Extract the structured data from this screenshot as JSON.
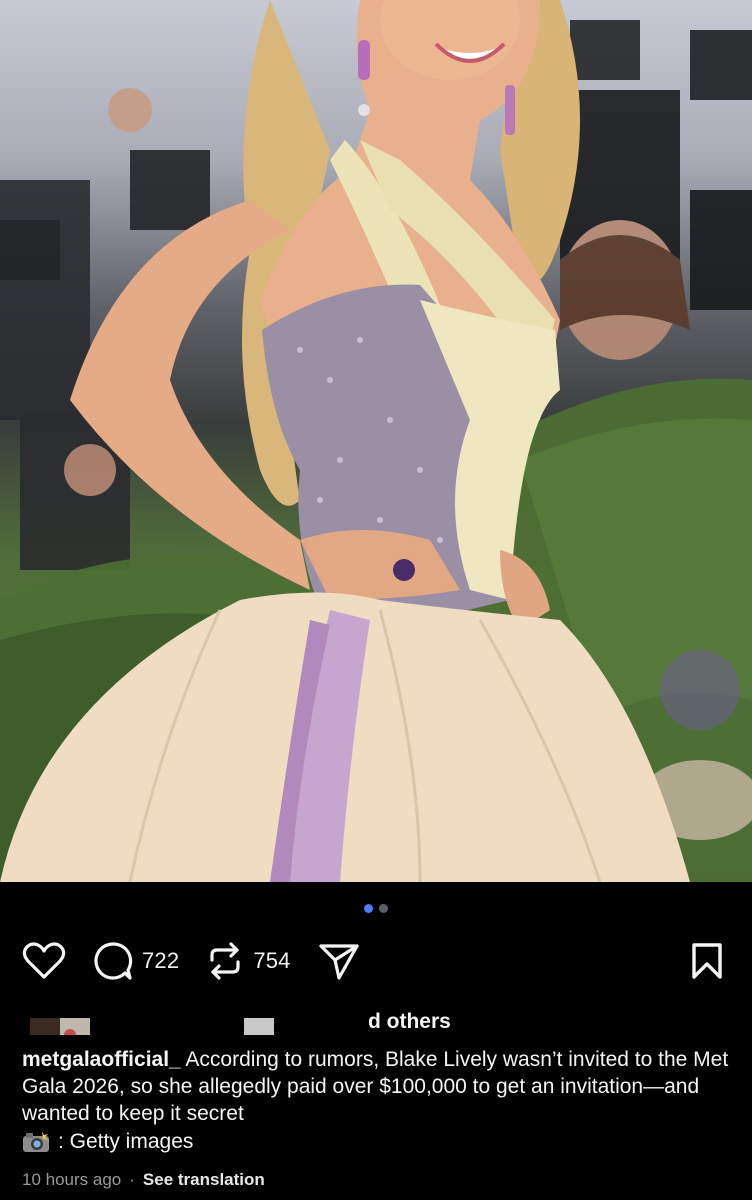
{
  "post": {
    "carousel": {
      "count": 2,
      "active": 1
    },
    "actions": {
      "like_icon": "heart-icon",
      "comment_icon": "comment-bubble-icon",
      "comment_count": "722",
      "repost_icon": "repost-icon",
      "repost_count": "754",
      "share_icon": "send-icon",
      "save_icon": "bookmark-icon"
    },
    "liked_by": {
      "text": "d others"
    },
    "caption": {
      "username": "metgalaofficial_",
      "text": "According to rumors, Blake Lively wasn’t invited to the Met Gala 2026, so she allegedly paid over $100,000 to get an invitation—and wanted to keep it secret"
    },
    "credit": {
      "icon": "camera-emoji",
      "text": ": Getty images"
    },
    "meta": {
      "time": "10 hours ago",
      "separator": "·",
      "translate": "See translation"
    },
    "colors": {
      "background": "#000000",
      "carousel_active": "#4f7cf7",
      "muted_text": "#9a9a9a"
    }
  }
}
